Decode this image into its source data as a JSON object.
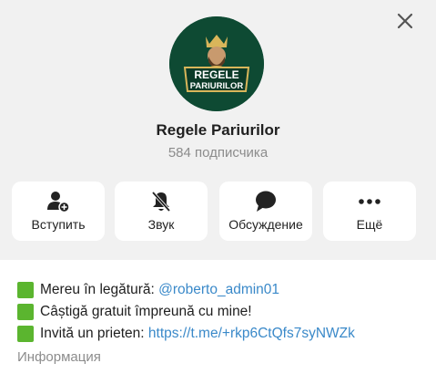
{
  "channel": {
    "title": "Regele Pariurilor",
    "subscribers": "584 подписчика",
    "logo_text_line1": "REGELE",
    "logo_text_line2": "PARIURILOR"
  },
  "actions": [
    {
      "label": "Вступить",
      "icon": "add-user-icon"
    },
    {
      "label": "Звук",
      "icon": "bell-muted-icon"
    },
    {
      "label": "Обсуждение",
      "icon": "chat-bubble-icon"
    },
    {
      "label": "Ещё",
      "icon": "more-dots-icon"
    }
  ],
  "description": {
    "line1_text": "Mereu în legătură: ",
    "line1_link": "@roberto_admin01",
    "line2_text": "Câștigă gratuit împreună cu mine!",
    "line3_text": "Invită un prieten: ",
    "line3_link": "https://t.me/+rkp6CtQfs7syNWZk",
    "label": "Информация"
  },
  "colors": {
    "header_bg": "#f1f1f1",
    "link": "#3a89c9",
    "emoji_square": "#5bb52f",
    "logo_bg": "#0e4a33",
    "logo_gold": "#d9b65a"
  }
}
